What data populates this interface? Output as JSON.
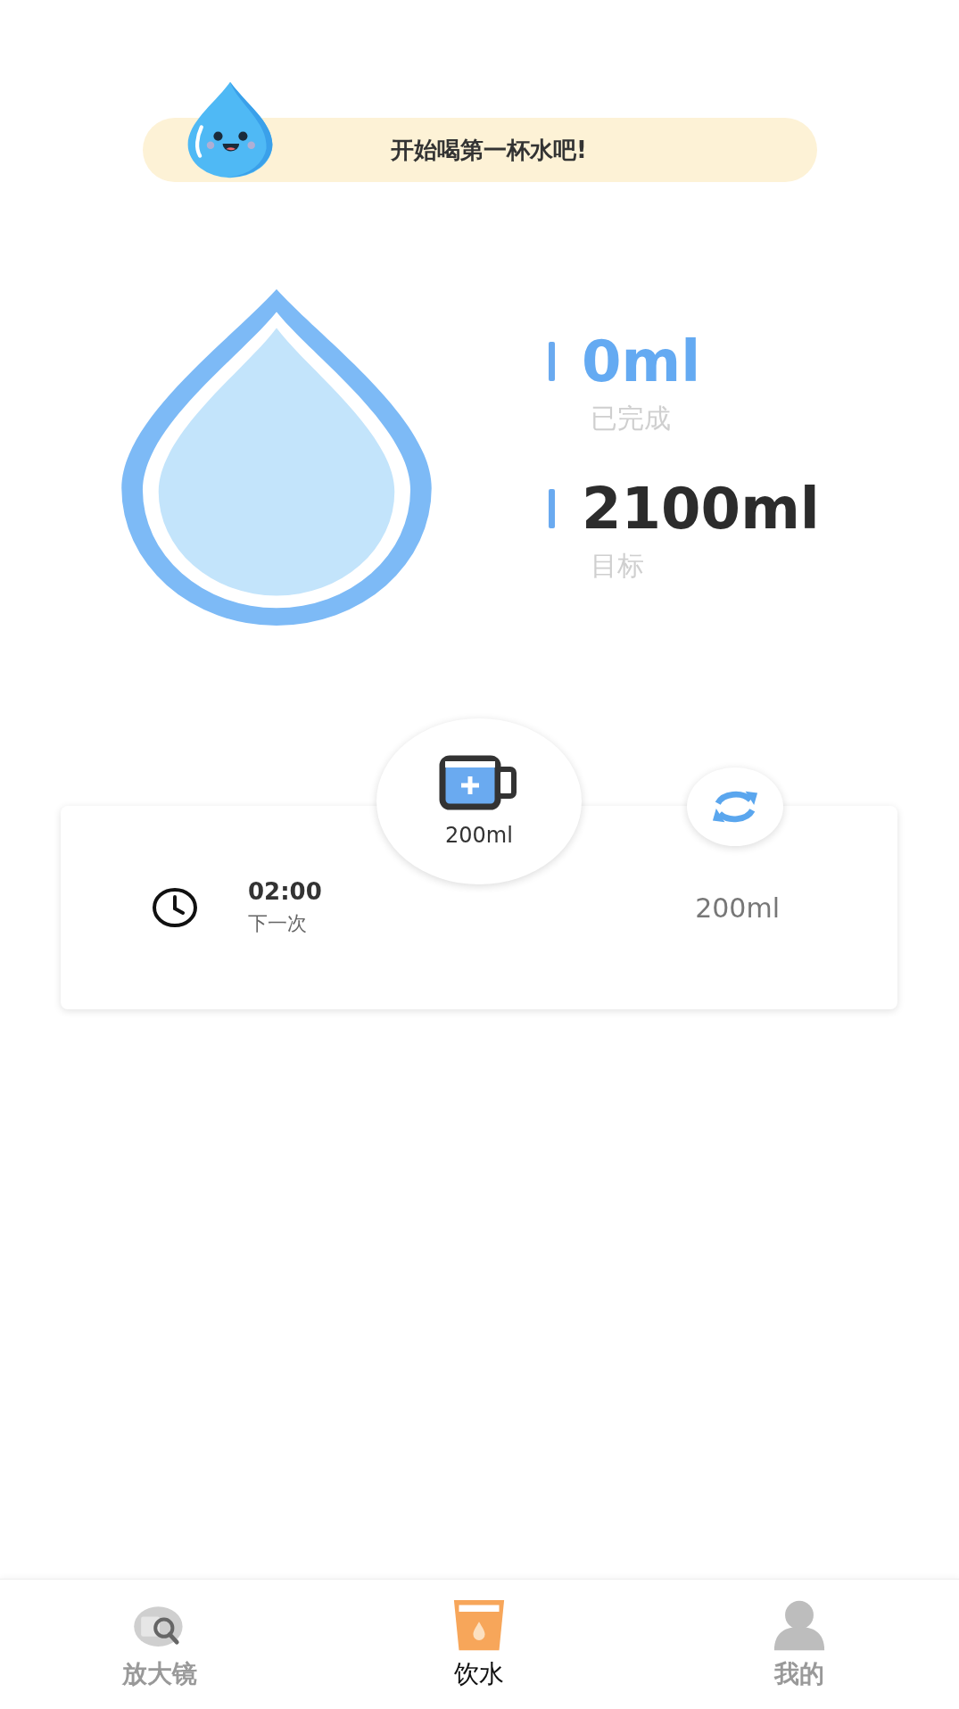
{
  "banner": {
    "message": "开始喝第一杯水吧!"
  },
  "stats": [
    {
      "kind": "done",
      "value": "0ml",
      "label": "已完成"
    },
    {
      "kind": "goal",
      "value": "2100ml",
      "label": "目标"
    }
  ],
  "cup_button": {
    "amount": "200ml"
  },
  "next": {
    "time": "02:00",
    "label": "下一次"
  },
  "cup_size": "200ml",
  "tabs": [
    {
      "kind": "magnifier",
      "label": "放大镜",
      "selected": false
    },
    {
      "kind": "water",
      "label": "饮水",
      "selected": true
    },
    {
      "kind": "profile",
      "label": "我的",
      "selected": false
    }
  ]
}
